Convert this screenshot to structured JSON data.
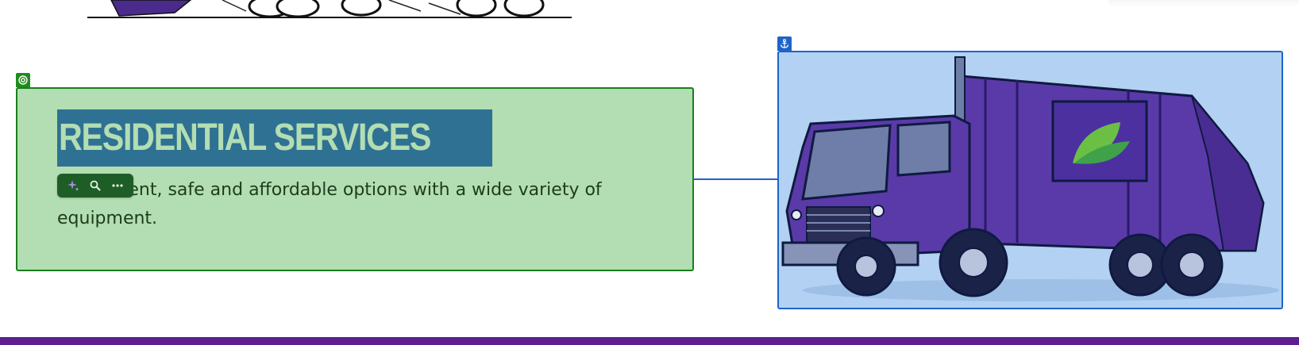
{
  "section": {
    "heading": "RESIDENTIAL SERVICES",
    "body_text": "Convenient, safe and affordable options with a wide variety of equipment."
  },
  "toolbar": {
    "buttons": [
      {
        "icon": "sparkle-icon"
      },
      {
        "icon": "search-icon"
      },
      {
        "icon": "more-icon"
      }
    ]
  },
  "badges": {
    "block_badge_icon": "target-icon",
    "image_badge_icon": "anchor-icon"
  },
  "colors": {
    "block_bg": "#b3ddb2",
    "block_border": "#1a7f1d",
    "heading_highlight": "#2e7193",
    "image_bg": "#b3d1f2",
    "image_border": "#1e64c8",
    "truck_purple": "#5a3aa8",
    "strip_purple": "#5b1f8f"
  }
}
